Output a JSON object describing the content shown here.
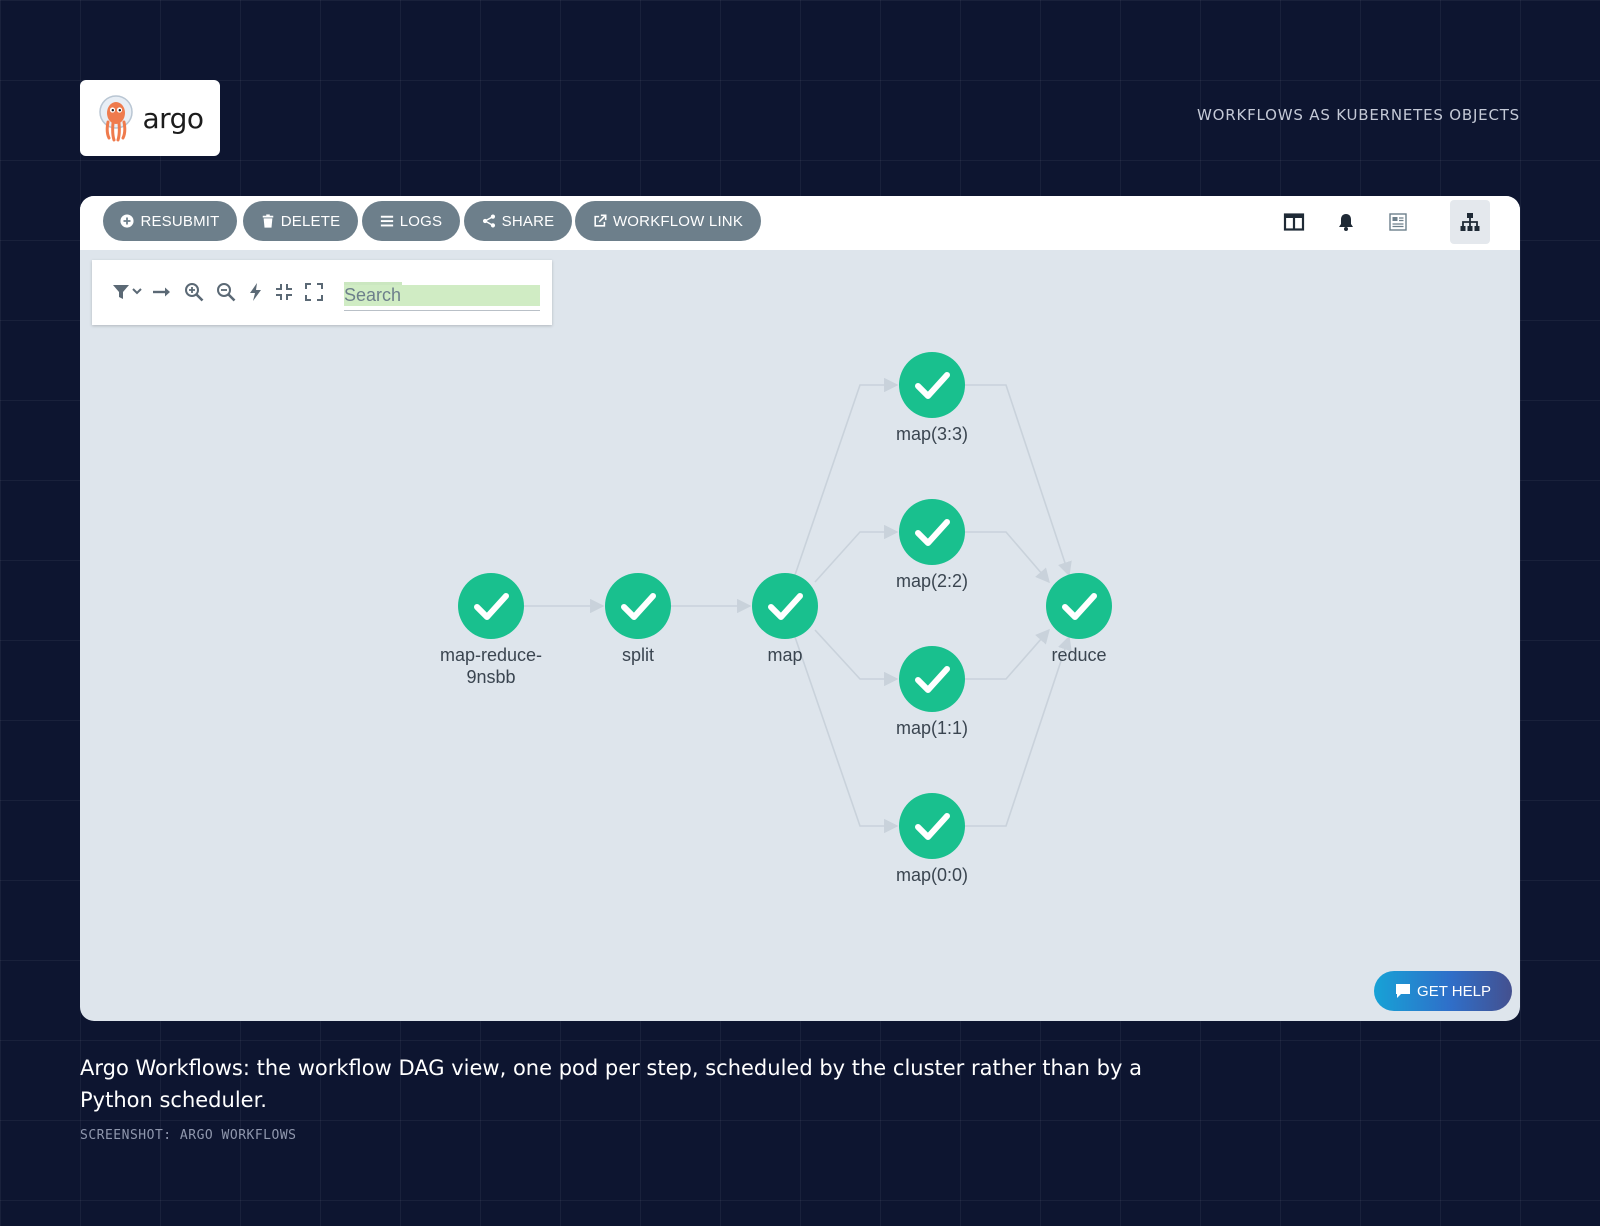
{
  "brand": {
    "logo_text": "argo",
    "mascot_icon": "octopus-mascot-icon"
  },
  "tagline": "WORKFLOWS AS KUBERNETES OBJECTS",
  "toolbar": {
    "buttons": [
      {
        "label": "RESUBMIT",
        "icon": "plus-circle-icon"
      },
      {
        "label": "DELETE",
        "icon": "trash-icon"
      },
      {
        "label": "LOGS",
        "icon": "list-icon"
      },
      {
        "label": "SHARE",
        "icon": "share-icon"
      },
      {
        "label": "WORKFLOW LINK",
        "icon": "external-link-icon"
      }
    ],
    "view_icons": [
      "split-view-icon",
      "bell-icon",
      "summary-icon",
      "tree-view-icon"
    ],
    "active_view": "tree-view-icon"
  },
  "graph_tools": {
    "icons": [
      "filter-icon",
      "direction-icon",
      "zoom-in-icon",
      "zoom-out-icon",
      "fast-forward-icon",
      "collapse-icon",
      "expand-icon"
    ],
    "search_placeholder": "Search"
  },
  "dag": {
    "status": "Succeeded",
    "status_color": "#19c08e",
    "nodes": [
      {
        "id": "root",
        "label": "map-reduce-9nsbb",
        "label_lines": [
          "map-reduce-",
          "9nsbb"
        ]
      },
      {
        "id": "split",
        "label": "split"
      },
      {
        "id": "map",
        "label": "map"
      },
      {
        "id": "m33",
        "label": "map(3:3)"
      },
      {
        "id": "m22",
        "label": "map(2:2)"
      },
      {
        "id": "m11",
        "label": "map(1:1)"
      },
      {
        "id": "m00",
        "label": "map(0:0)"
      },
      {
        "id": "reduce",
        "label": "reduce"
      }
    ],
    "edges": [
      [
        "root",
        "split"
      ],
      [
        "split",
        "map"
      ],
      [
        "map",
        "m33"
      ],
      [
        "map",
        "m22"
      ],
      [
        "map",
        "m11"
      ],
      [
        "map",
        "m00"
      ],
      [
        "m33",
        "reduce"
      ],
      [
        "m22",
        "reduce"
      ],
      [
        "m11",
        "reduce"
      ],
      [
        "m00",
        "reduce"
      ]
    ]
  },
  "help": {
    "label": "GET HELP",
    "icon": "chat-icon"
  },
  "caption": "Argo Workflows: the workflow DAG view, one pod per step, scheduled by the cluster rather than by a Python scheduler.",
  "credit": "SCREENSHOT: ARGO WORKFLOWS"
}
